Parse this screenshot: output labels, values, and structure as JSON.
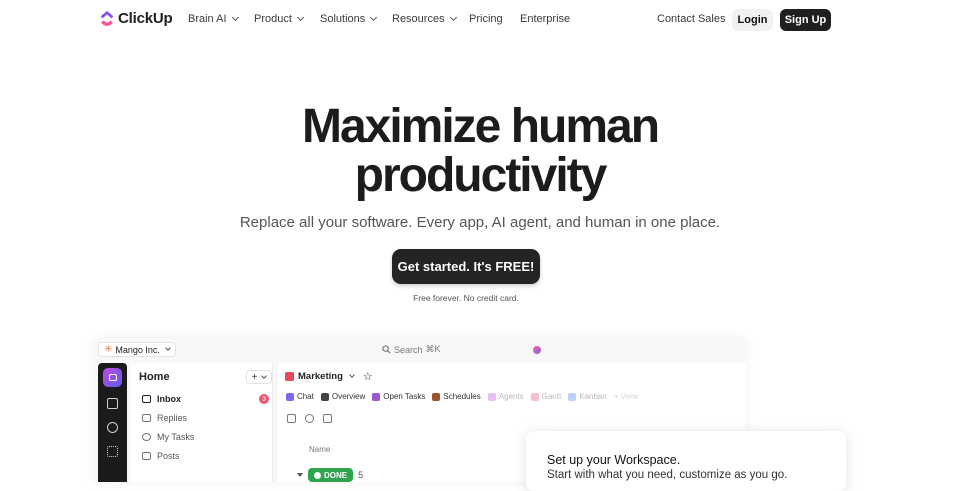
{
  "nav": {
    "logo": "ClickUp",
    "items": [
      {
        "label": "Brain AI",
        "dropdown": true
      },
      {
        "label": "Product",
        "dropdown": true
      },
      {
        "label": "Solutions",
        "dropdown": true
      },
      {
        "label": "Resources",
        "dropdown": true
      },
      {
        "label": "Pricing",
        "dropdown": false
      },
      {
        "label": "Enterprise",
        "dropdown": false
      }
    ],
    "contact": "Contact Sales",
    "login": "Login",
    "signup": "Sign Up"
  },
  "hero": {
    "title_line1": "Maximize human",
    "title_line2": "productivity",
    "subtitle": "Replace all your software. Every app, AI agent, and human in one place.",
    "cta": "Get started. It's FREE!",
    "note": "Free forever. No credit card."
  },
  "app": {
    "workspace": "Mango Inc.",
    "search": "Search",
    "search_shortcut": "⌘K",
    "sidebar": {
      "title": "Home",
      "add": "+",
      "items": [
        "Inbox",
        "Replies",
        "My Tasks",
        "Posts"
      ],
      "inbox_count": "3"
    },
    "main": {
      "space": "Marketing",
      "tabs": [
        "Chat",
        "Overview",
        "Open Tasks",
        "Schedules",
        "Agents",
        "Gantt",
        "Kanban",
        "+ View"
      ],
      "column": "Name",
      "status": "DONE",
      "status_count": "5"
    }
  },
  "modal": {
    "title": "Set up your Workspace.",
    "subtitle": "Start with what you need, customize as you go."
  },
  "colors": {
    "brand_dark": "#1f1f20",
    "done_green": "#2ea44f",
    "badge_red": "#f0536d",
    "marketing_red": "#e8465b"
  }
}
